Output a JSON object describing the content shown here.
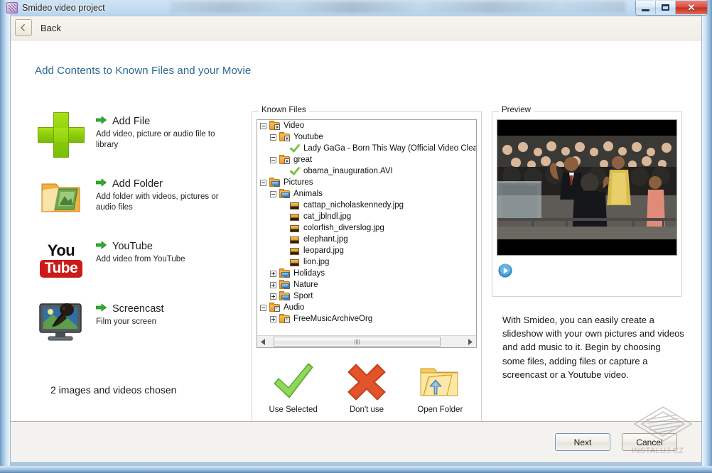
{
  "window": {
    "title": "Smideo video project",
    "app_icon": "app-icon",
    "controls": {
      "minimize": "minimize-button",
      "maximize": "maximize-button",
      "close": "close-button",
      "close_glyph": "✕"
    }
  },
  "toolbar": {
    "back_label": "Back",
    "back_icon": "back-arrow-icon"
  },
  "page": {
    "title": "Add Contents to Known Files and your Movie",
    "title_color": "#2b6a95"
  },
  "options": [
    {
      "icon": "green-plus-icon",
      "title": "Add File",
      "desc": "Add video, picture or audio file to library"
    },
    {
      "icon": "folder-with-pictures-icon",
      "title": "Add Folder",
      "desc": "Add folder with videos, pictures or audio files"
    },
    {
      "icon": "youtube-logo-icon",
      "title": "YouTube",
      "desc": "Add video from YouTube",
      "logo_top": "You",
      "logo_bottom": "Tube"
    },
    {
      "icon": "monitor-screencast-icon",
      "title": "Screencast",
      "desc": "Film your screen"
    }
  ],
  "status": {
    "chosen": "2 images and videos chosen"
  },
  "known_files": {
    "legend": "Known Files",
    "tree": [
      {
        "label": "Video",
        "depth": 0,
        "expander": "minus",
        "icon": "video-folder-icon"
      },
      {
        "label": "Youtube",
        "depth": 1,
        "expander": "minus",
        "icon": "video-folder-icon"
      },
      {
        "label": "Lady GaGa - Born This Way (Official Video Clean V",
        "depth": 2,
        "expander": "none",
        "icon": "green-check-icon"
      },
      {
        "label": "great",
        "depth": 1,
        "expander": "minus",
        "icon": "video-folder-icon"
      },
      {
        "label": "obama_inauguration.AVI",
        "depth": 2,
        "expander": "none",
        "icon": "green-check-icon"
      },
      {
        "label": "Pictures",
        "depth": 0,
        "expander": "minus",
        "icon": "picture-folder-icon"
      },
      {
        "label": "Animals",
        "depth": 1,
        "expander": "minus",
        "icon": "picture-folder-icon"
      },
      {
        "label": "cattap_nicholaskennedy.jpg",
        "depth": 2,
        "expander": "none",
        "icon": "photo-file-icon"
      },
      {
        "label": "cat_jblndl.jpg",
        "depth": 2,
        "expander": "none",
        "icon": "photo-file-icon"
      },
      {
        "label": "colorfish_diverslog.jpg",
        "depth": 2,
        "expander": "none",
        "icon": "photo-file-icon"
      },
      {
        "label": "elephant.jpg",
        "depth": 2,
        "expander": "none",
        "icon": "photo-file-icon"
      },
      {
        "label": "leopard.jpg",
        "depth": 2,
        "expander": "none",
        "icon": "photo-file-icon"
      },
      {
        "label": "lion.jpg",
        "depth": 2,
        "expander": "none",
        "icon": "photo-file-icon"
      },
      {
        "label": "Holidays",
        "depth": 1,
        "expander": "plus",
        "icon": "picture-folder-icon"
      },
      {
        "label": "Nature",
        "depth": 1,
        "expander": "plus",
        "icon": "picture-folder-icon"
      },
      {
        "label": "Sport",
        "depth": 1,
        "expander": "plus",
        "icon": "picture-folder-icon"
      },
      {
        "label": "Audio",
        "depth": 0,
        "expander": "minus",
        "icon": "audio-folder-icon"
      },
      {
        "label": "FreeMusicArchiveOrg",
        "depth": 1,
        "expander": "plus",
        "icon": "audio-folder-icon"
      }
    ],
    "scrollbar": {
      "left_arrow": "◄",
      "right_arrow": "►"
    }
  },
  "actions": [
    {
      "icon": "green-check-icon",
      "label": "Use Selected"
    },
    {
      "icon": "red-x-icon",
      "label": "Don't use"
    },
    {
      "icon": "open-folder-icon",
      "label": "Open Folder"
    }
  ],
  "preview": {
    "legend": "Preview",
    "image_alt": "obama-inauguration-video-frame",
    "play_button": "play-icon"
  },
  "description": {
    "text": "With Smideo, you can easily create a slideshow with your own pictures and videos and add music to it. Begin by choosing some files, adding files or capture a screencast or a Youtube video."
  },
  "command_bar": {
    "next_label": "Next",
    "cancel_label": "Cancel"
  },
  "watermark": {
    "text": "INSTALUJ.CZ"
  }
}
